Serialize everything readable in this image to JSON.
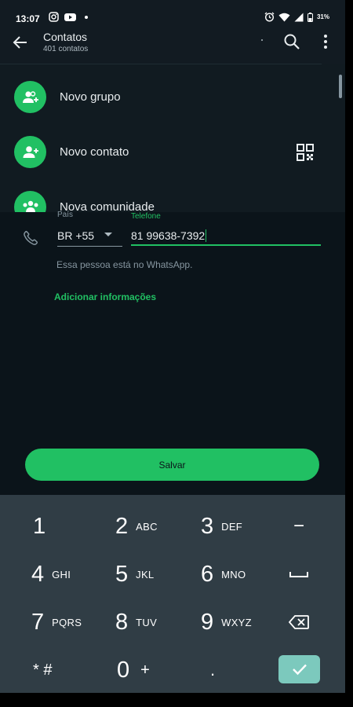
{
  "status_bar": {
    "time": "13:07",
    "battery": "31%"
  },
  "app_bar": {
    "title": "Contatos",
    "subtitle": "401 contatos"
  },
  "list": {
    "items": [
      {
        "label": "Novo grupo"
      },
      {
        "label": "Novo contato"
      },
      {
        "label": "Nova comunidade"
      }
    ]
  },
  "form": {
    "country_label": "País",
    "country_value": "BR +55",
    "phone_label": "Telefone",
    "phone_value": "81 99638-7392",
    "hint": "Essa pessoa está no WhatsApp.",
    "add_info_link": "Adicionar informações",
    "save_label": "Salvar"
  },
  "keypad": {
    "keys": [
      {
        "num": "1",
        "letters": ""
      },
      {
        "num": "2",
        "letters": "ABC"
      },
      {
        "num": "3",
        "letters": "DEF"
      },
      {
        "num": "4",
        "letters": "GHI"
      },
      {
        "num": "5",
        "letters": "JKL"
      },
      {
        "num": "6",
        "letters": "MNO"
      },
      {
        "num": "7",
        "letters": "PQRS"
      },
      {
        "num": "8",
        "letters": "TUV"
      },
      {
        "num": "9",
        "letters": "WXYZ"
      },
      {
        "num": "* #",
        "letters": ""
      },
      {
        "num": "0",
        "letters": "+"
      },
      {
        "num": ".",
        "letters": ""
      }
    ],
    "minus": "−"
  },
  "colors": {
    "accent": "#21c063",
    "background": "#0b141a",
    "keypad": "#303d45",
    "done": "#7cc9bd"
  }
}
